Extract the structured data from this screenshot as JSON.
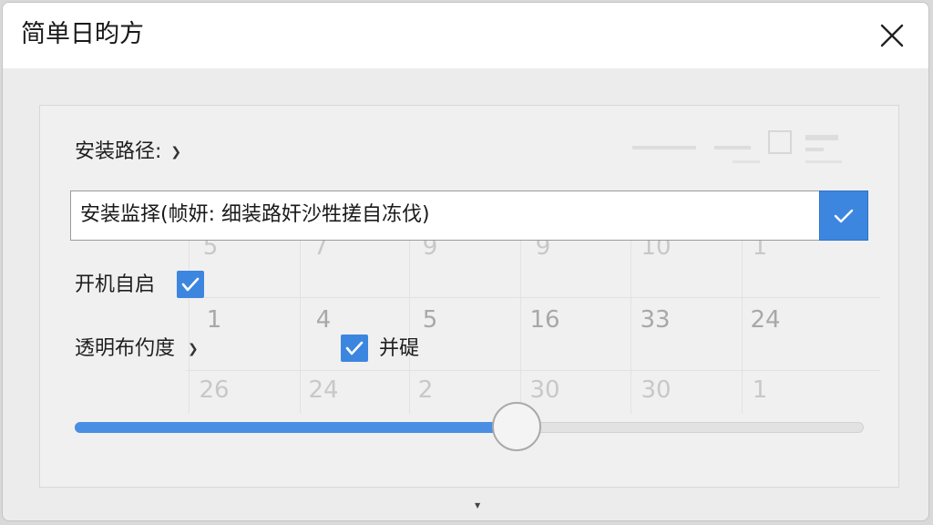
{
  "window": {
    "title": "简单日昀方",
    "close_icon": "close-icon"
  },
  "settings": {
    "install_path_label": "安装路径:",
    "install_path_value": "安装监择(帧妍: 细装路奸沙牲搓自冻伐)",
    "autostart_label": "开机自启",
    "autostart_checked": true,
    "transparency_label": "透明布仢度",
    "option_label": "并碮",
    "option_checked": true,
    "transparency_level": 0.56
  },
  "background_numbers": {
    "row1": [
      "5",
      "7",
      "9",
      "9",
      "10",
      "1"
    ],
    "row2": [
      "1",
      "4",
      "5",
      "16",
      "33",
      "24"
    ],
    "row3": [
      "26",
      "24",
      "2",
      "30",
      "30",
      "1"
    ]
  },
  "colors": {
    "accent": "#3d86e0",
    "slider_fill": "#4a8ee3",
    "panel_bg": "#f0f0f0",
    "titlebar_bg": "#ffffff"
  }
}
